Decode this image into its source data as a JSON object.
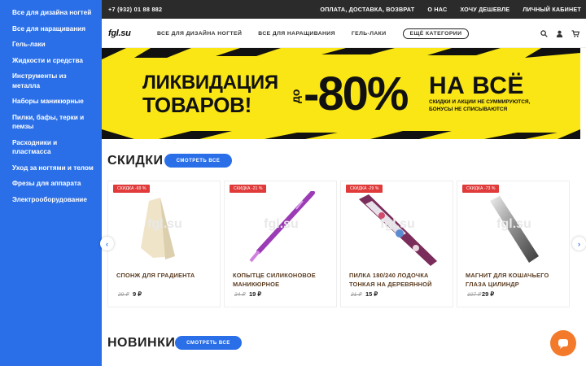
{
  "sidebar": {
    "items": [
      {
        "label": "Все для дизайна ногтей"
      },
      {
        "label": "Все для наращивания"
      },
      {
        "label": "Гель-лаки"
      },
      {
        "label": "Жидкости и средства"
      },
      {
        "label": "Инструменты из металла"
      },
      {
        "label": "Наборы маникюрные"
      },
      {
        "label": "Пилки, бафы, терки и пемзы"
      },
      {
        "label": "Расходники и пластмасса"
      },
      {
        "label": "Уход за ногтями и телом"
      },
      {
        "label": "Фрезы для аппарата"
      },
      {
        "label": "Электрооборудование"
      }
    ]
  },
  "topbar": {
    "phone": "+7 (932) 01 88 882",
    "links": [
      "ОПЛАТА, ДОСТАВКА, ВОЗВРАТ",
      "О НАС",
      "ХОЧУ ДЕШЕВЛЕ",
      "ЛИЧНЫЙ КАБИНЕТ"
    ]
  },
  "header": {
    "logo": "fgl.su",
    "nav": [
      "ВСЕ ДЛЯ ДИЗАЙНА НОГТЕЙ",
      "ВСЕ ДЛЯ НАРАЩИВАНИЯ",
      "ГЕЛЬ-ЛАКИ"
    ],
    "more": "ЕЩЁ КАТЕГОРИИ",
    "icons": [
      "search-icon",
      "user-icon",
      "cart-icon"
    ]
  },
  "banner": {
    "line1": "ЛИКВИДАЦИЯ",
    "line2": "ТОВАРОВ!",
    "upto": "до",
    "discount": "-80%",
    "all": "НА ВСЁ",
    "note1": "СКИДКИ И АКЦИИ НЕ СУММИРУЮТСЯ,",
    "note2": "БОНУСЫ НЕ СПИСЫВАЮТСЯ",
    "colors": {
      "bg": "#fae614",
      "stripe": "#111111"
    }
  },
  "sections": {
    "discounts": {
      "title": "СКИДКИ",
      "button": "СМОТРЕТЬ ВСЕ"
    },
    "new": {
      "title": "НОВИНКИ",
      "button": "СМОТРЕТЬ ВСЕ"
    }
  },
  "products": [
    {
      "badge": "СКИДКА -69 %",
      "name": "СПОНЖ ДЛЯ ГРАДИЕНТА",
      "old_price": "29 ₽",
      "price": "9 ₽",
      "watermark": "fgl.su"
    },
    {
      "badge": "СКИДКА -21 %",
      "name": "КОПЫТЦЕ СИЛИКОНОВОЕ МАНИКЮРНОЕ",
      "old_price": "24 ₽",
      "price": "19 ₽",
      "watermark": "fgl.su"
    },
    {
      "badge": "СКИДКА -29 %",
      "name": "ПИЛКА 180/240 ЛОДОЧКА ТОНКАЯ НА ДЕРЕВЯННОЙ",
      "old_price": "21 ₽",
      "price": "15 ₽",
      "watermark": "fgl.su"
    },
    {
      "badge": "СКИДКА -73 %",
      "name": "МАГНИТ ДЛЯ КОШАЧЬЕГО ГЛАЗА ЦИЛИНДР",
      "old_price": "107 ₽",
      "price": "29 ₽",
      "watermark": "fgl.su"
    }
  ],
  "colors": {
    "accent": "#2a6fe8",
    "badge": "#e03a3a",
    "chat": "#f47a2b",
    "topbar": "#2b2b2b"
  }
}
